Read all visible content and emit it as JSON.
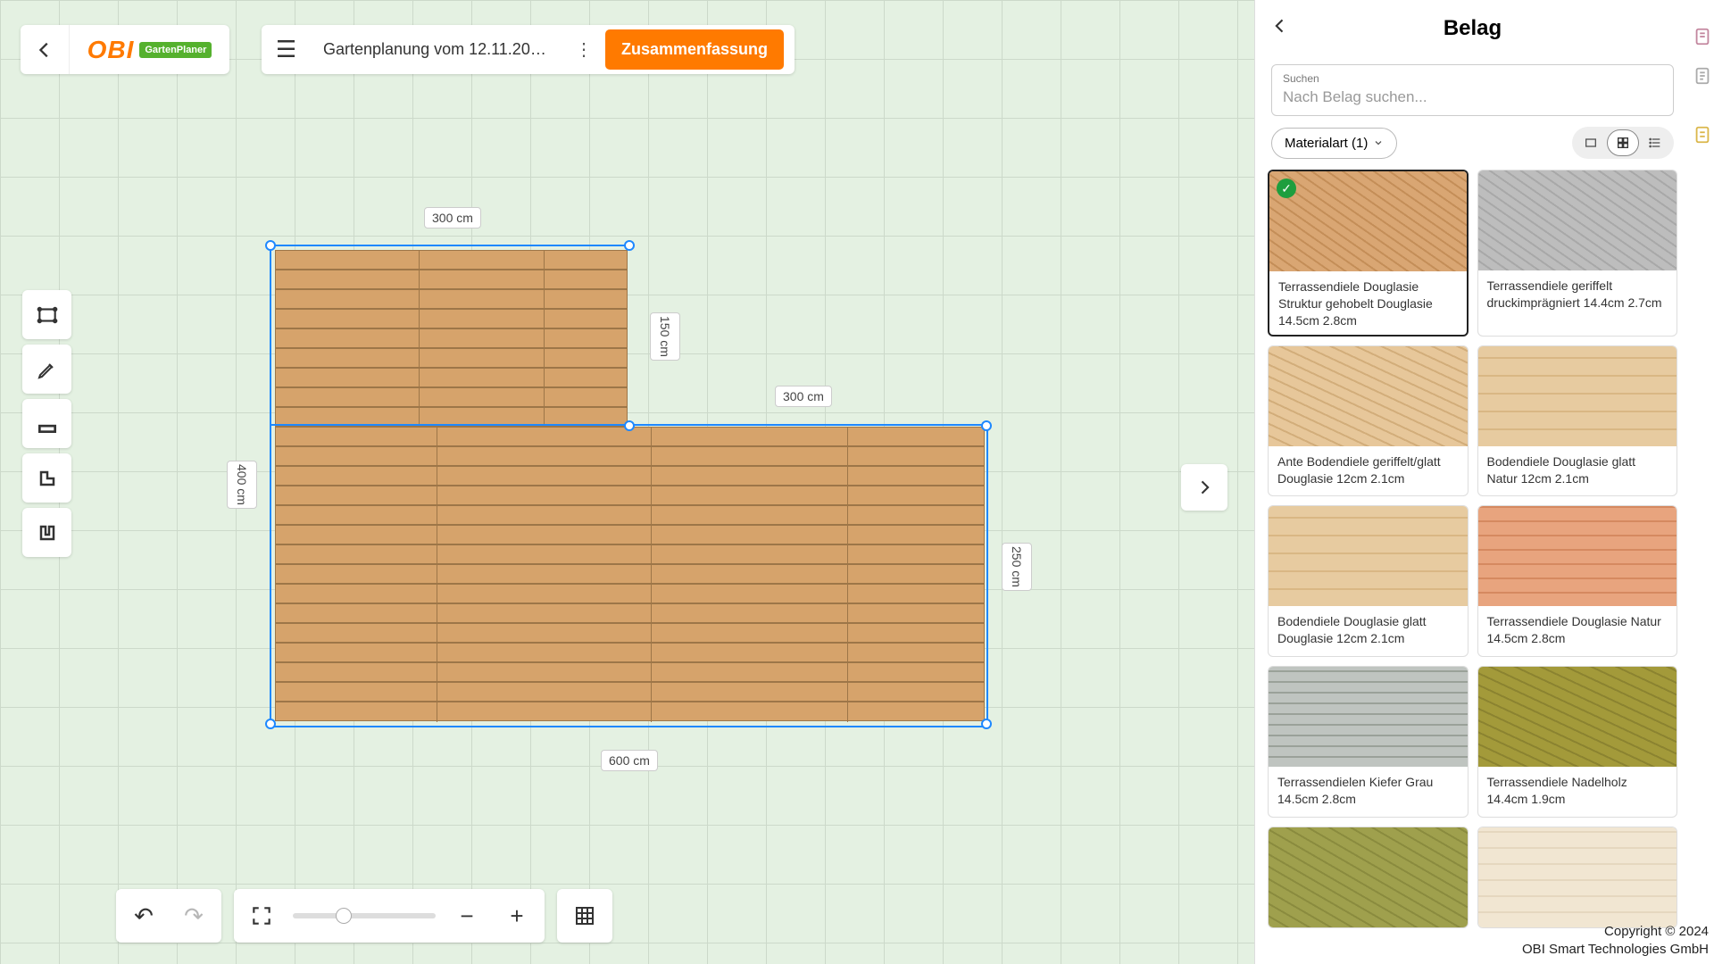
{
  "header": {
    "project_title": "Gartenplanung vom 12.11.2024 1...",
    "summary_label": "Zusammenfassung",
    "logo_text": "OBI",
    "logo_badge": "GartenPlaner"
  },
  "canvas": {
    "dims": {
      "top": "300 cm",
      "leftSide": "400 cm",
      "rightUpper": "150 cm",
      "rightMiddle": "300 cm",
      "rightLower": "250 cm",
      "bottom": "600 cm"
    }
  },
  "panel": {
    "title": "Belag",
    "search_label": "Suchen",
    "search_placeholder": "Nach Belag suchen...",
    "filter_chip": "Materialart (1)"
  },
  "materials": [
    {
      "name": "Terrassendiele Douglasie Struktur gehobelt Douglasie 14.5cm 2.8cm",
      "tex": "tex-doug1",
      "selected": true
    },
    {
      "name": "Terrassendiele geriffelt druckimprägniert 14.4cm 2.7cm",
      "tex": "tex-ggrey",
      "selected": false
    },
    {
      "name": "Ante Bodendiele geriffelt/glatt Douglasie 12cm 2.1cm",
      "tex": "tex-doug2",
      "selected": false
    },
    {
      "name": "Bodendiele Douglasie glatt Natur 12cm 2.1cm",
      "tex": "tex-doug3",
      "selected": false
    },
    {
      "name": "Bodendiele Douglasie glatt Douglasie 12cm 2.1cm",
      "tex": "tex-doug3",
      "selected": false
    },
    {
      "name": "Terrassendiele Douglasie Natur 14.5cm 2.8cm",
      "tex": "tex-pink",
      "selected": false
    },
    {
      "name": "Terrassendielen Kiefer Grau 14.5cm 2.8cm",
      "tex": "tex-grey",
      "selected": false
    },
    {
      "name": "Terrassendiele Nadelholz 14.4cm 1.9cm",
      "tex": "tex-olive",
      "selected": false
    },
    {
      "name": "",
      "tex": "tex-green",
      "selected": false
    },
    {
      "name": "",
      "tex": "tex-pale",
      "selected": false
    }
  ],
  "footer": {
    "copyright_line1": "Copyright © 2024",
    "copyright_line2": "OBI Smart Technologies GmbH"
  }
}
